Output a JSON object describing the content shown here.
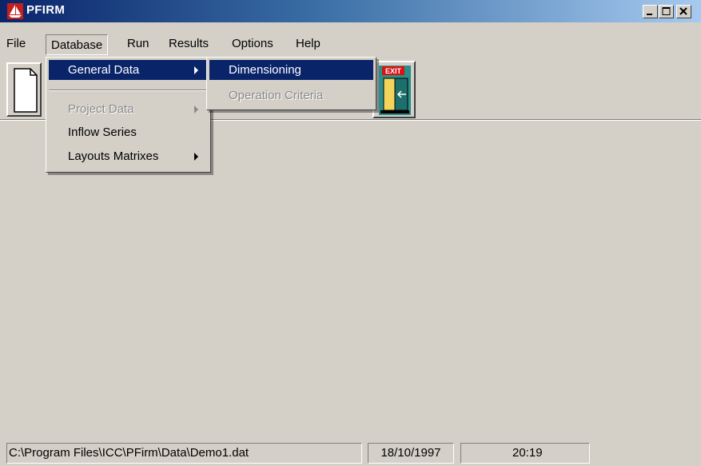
{
  "window": {
    "title": "PFIRM"
  },
  "menubar": {
    "items": [
      {
        "label": "File"
      },
      {
        "label": "Database"
      },
      {
        "label": "Run"
      },
      {
        "label": "Results"
      },
      {
        "label": "Options"
      },
      {
        "label": "Help"
      }
    ]
  },
  "database_menu": {
    "items": [
      {
        "label": "General Data",
        "state": "highlighted",
        "submenu": true
      },
      {
        "label": "Project Data",
        "state": "disabled",
        "submenu": true
      },
      {
        "label": "Inflow Series",
        "state": "normal",
        "submenu": false
      },
      {
        "label": "Layouts Matrixes",
        "state": "normal",
        "submenu": true
      }
    ]
  },
  "general_data_submenu": {
    "items": [
      {
        "label": "Dimensioning",
        "state": "highlighted"
      },
      {
        "label": "Operation Criteria",
        "state": "disabled"
      }
    ]
  },
  "toolbar": {
    "buttons": [
      {
        "icon": "new-document-icon"
      },
      {
        "icon": "exit-door-icon",
        "label": "EXIT"
      }
    ]
  },
  "statusbar": {
    "file_path": "C:\\Program Files\\ICC\\PFirm\\Data\\Demo1.dat",
    "date": "18/10/1997",
    "time": "20:19"
  },
  "colors": {
    "title_gradient_start": "#0a246a",
    "title_gradient_end": "#a6caf0",
    "highlight": "#0a246a",
    "face": "#d4d0c8",
    "disabled_text": "#8a8a8a"
  }
}
